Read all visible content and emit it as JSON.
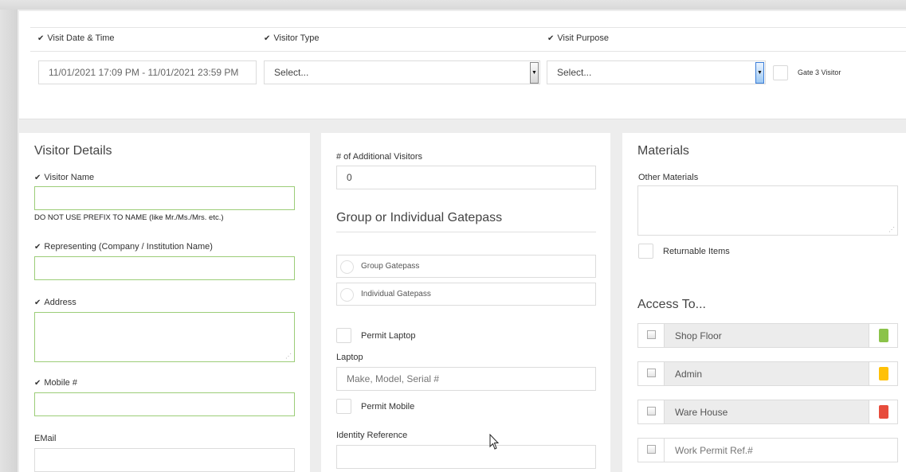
{
  "top": {
    "visit_date_label": "Visit Date & Time",
    "visitor_type_label": "Visitor Type",
    "visit_purpose_label": "Visit Purpose",
    "visit_date_value": "11/01/2021 17:09 PM - 11/01/2021 23:59 PM",
    "visitor_type_value": "Select...",
    "visit_purpose_value": "Select...",
    "gate3_label": "Gate 3 Visitor"
  },
  "visitor": {
    "title": "Visitor Details",
    "name_label": "Visitor Name",
    "name_note": "DO NOT USE PREFIX TO NAME (like Mr./Ms./Mrs. etc.)",
    "representing_label": "Representing (Company / Institution Name)",
    "address_label": "Address",
    "mobile_label": "Mobile #",
    "email_label": "EMail"
  },
  "middle": {
    "additional_label": "# of Additional Visitors",
    "additional_value": "0",
    "gatepass_title": "Group or Individual Gatepass",
    "group_gatepass": "Group Gatepass",
    "individual_gatepass": "Individual Gatepass",
    "permit_laptop": "Permit Laptop",
    "laptop_label": "Laptop",
    "laptop_placeholder": "Make, Model, Serial #",
    "permit_mobile": "Permit Mobile",
    "identity_label": "Identity Reference"
  },
  "materials": {
    "title": "Materials",
    "other_label": "Other Materials",
    "returnable_label": "Returnable Items"
  },
  "access": {
    "title": "Access To...",
    "items": [
      {
        "name": "Shop Floor",
        "color": "#8bc34a"
      },
      {
        "name": "Admin",
        "color": "#ffc107"
      },
      {
        "name": "Ware House",
        "color": "#e74c3c"
      }
    ],
    "work_permit_placeholder": "Work Permit Ref.#"
  },
  "icons": {
    "check": "✔",
    "select_arrow": "▼"
  },
  "colors": {
    "valid_border": "#9ccd78"
  }
}
